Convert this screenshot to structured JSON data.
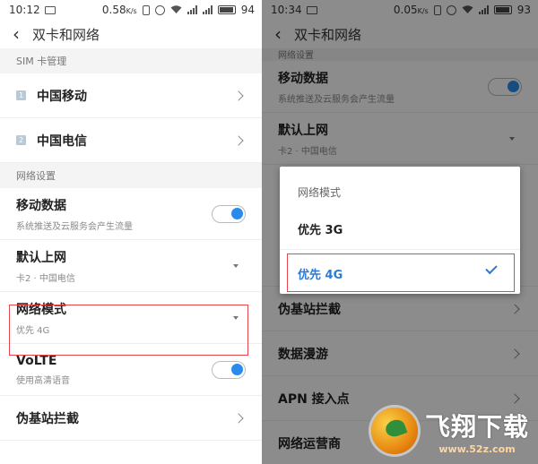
{
  "left": {
    "status": {
      "time": "10:12",
      "speed": "0.58",
      "speed_unit": "K/s",
      "battery": "94"
    },
    "title": "双卡和网络",
    "sim_header": "SIM 卡管理",
    "sims": [
      {
        "badge": "1",
        "label": "中国移动"
      },
      {
        "badge": "2",
        "label": "中国电信"
      }
    ],
    "network_header": "网络设置",
    "rows": [
      {
        "title": "移动数据",
        "sub": "系统推送及云服务会产生流量",
        "control": "toggle"
      },
      {
        "title": "默认上网",
        "sub": "卡2 · 中国电信",
        "control": "dropdown"
      },
      {
        "title": "网络模式",
        "sub": "优先 4G",
        "control": "dropdown"
      },
      {
        "title": "VoLTE",
        "sub": "使用高清语音",
        "control": "toggle"
      },
      {
        "title": "伪基站拦截",
        "sub": "",
        "control": "chevron"
      }
    ]
  },
  "right": {
    "status": {
      "time": "10:34",
      "speed": "0.05",
      "speed_unit": "K/s",
      "battery": "93"
    },
    "title": "双卡和网络",
    "network_header": "网络设置",
    "rows": [
      {
        "title": "移动数据",
        "sub": "系统推送及云服务会产生流量"
      },
      {
        "title": "默认上网",
        "sub": "卡2 · 中国电信"
      },
      {
        "title": "伪基站拦截"
      },
      {
        "title": "数据漫游"
      },
      {
        "title": "APN 接入点"
      },
      {
        "title": "网络运营商"
      }
    ],
    "dialog": {
      "title": "网络模式",
      "options": [
        "优先 3G",
        "优先 4G"
      ],
      "selected": "优先 4G"
    }
  },
  "watermark": {
    "brand": "飞翔下载",
    "url": "www.52z.com"
  },
  "colors": {
    "accent": "#2a7ad6",
    "highlight": "#e8464d",
    "toggle_on": "#2a8bea"
  }
}
